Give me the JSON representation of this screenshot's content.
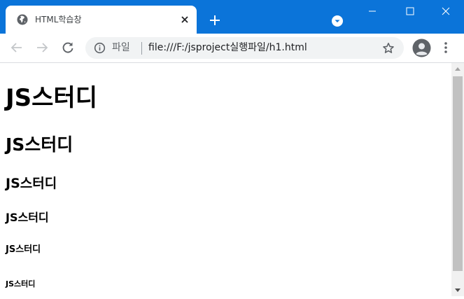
{
  "tab": {
    "title": "HTML학습창",
    "favicon": "globe-icon",
    "close": "close-icon"
  },
  "toolbar": {
    "back": "arrow-back-icon",
    "forward": "arrow-forward-icon",
    "reload": "reload-icon",
    "scheme_label": "파일",
    "url": "file:///F:/jsproject실행파일/h1.html",
    "bookmark": "star-icon",
    "menu": "vertical-dots-icon"
  },
  "colors": {
    "titlebar": "#0b74d9",
    "toolbar": "#ffffff",
    "omnibox": "#f1f3f4",
    "scrollbar_thumb": "#c1c1c1"
  },
  "page": {
    "h1": "JS스터디",
    "h2": "JS스터디",
    "h3": "JS스터디",
    "h4": "JS스터디",
    "h5": "JS스터디",
    "h6": "JS스터디"
  }
}
